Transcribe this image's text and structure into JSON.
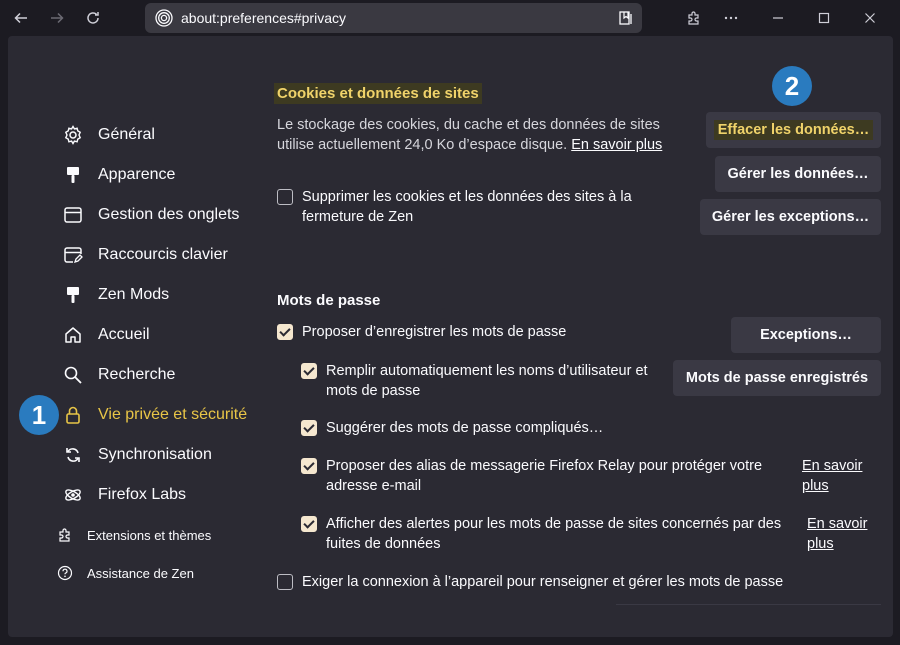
{
  "browser": {
    "url": "about:preferences#privacy"
  },
  "sidebar": {
    "items": [
      {
        "label": "Général",
        "icon": "gear-icon"
      },
      {
        "label": "Apparence",
        "icon": "brush-icon"
      },
      {
        "label": "Gestion des onglets",
        "icon": "tab-window-icon"
      },
      {
        "label": "Raccourcis clavier",
        "icon": "edit-window-icon"
      },
      {
        "label": "Zen Mods",
        "icon": "brush-icon"
      },
      {
        "label": "Accueil",
        "icon": "home-icon"
      },
      {
        "label": "Recherche",
        "icon": "search-icon"
      },
      {
        "label": "Vie privée et sécurité",
        "icon": "lock-icon",
        "active": true
      },
      {
        "label": "Synchronisation",
        "icon": "sync-icon"
      },
      {
        "label": "Firefox Labs",
        "icon": "atom-icon"
      }
    ],
    "bottom": [
      {
        "label": "Extensions et thèmes",
        "icon": "puzzle-icon"
      },
      {
        "label": "Assistance de Zen",
        "icon": "help-icon"
      }
    ]
  },
  "badges": {
    "one": "1",
    "two": "2"
  },
  "cookies": {
    "title": "Cookies et données de sites",
    "desc_line1": "Le stockage des cookies, du cache et des données de sites",
    "desc_line2": "utilise actuellement 24,0 Ko d’espace disque.",
    "learn_more": "En savoir plus",
    "clear_button": "Effacer les données…",
    "manage_button": "Gérer les données…",
    "exceptions_button": "Gérer les exceptions…",
    "delete_on_close_line1": "Supprimer les cookies et les données des sites à la",
    "delete_on_close_line2": "fermeture de Zen"
  },
  "passwords": {
    "title": "Mots de passe",
    "ask_save": "Proposer d’enregistrer les mots de passe",
    "exceptions_button": "Exceptions…",
    "saved_button": "Mots de passe enregistrés",
    "autofill_line1": "Remplir automatiquement les noms d’utilisateur et",
    "autofill_line2": "mots de passe",
    "suggest": "Suggérer des mots de passe compliqués…",
    "relay_line1": "Proposer des alias de messagerie Firefox Relay pour protéger votre",
    "relay_line2": "adresse e-mail",
    "relay_learn1": "En savoir",
    "relay_learn2": "plus",
    "breach_line1": "Afficher des alertes pour les mots de passe de sites concernés par des",
    "breach_line2": "fuites de données",
    "breach_learn1": "En savoir",
    "breach_learn2": "plus",
    "device_auth": "Exiger la connexion à l’appareil pour renseigner et gérer les mots de passe"
  },
  "colors": {
    "accent_highlight": "#f0d36a",
    "active_nav": "#e8c547",
    "badge": "#2a7bbf"
  }
}
